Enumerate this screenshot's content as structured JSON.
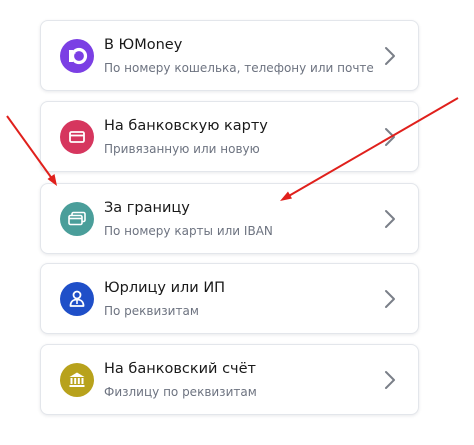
{
  "options": [
    {
      "title": "В ЮMoney",
      "subtitle": "По номеру кошелька, телефону или почте",
      "icon": "yoomoney-logo-icon",
      "color": "#7b3fe4"
    },
    {
      "title": "На банковскую карту",
      "subtitle": "Привязанную или новую",
      "icon": "bank-card-icon",
      "color": "#d6365e"
    },
    {
      "title": "За границу",
      "subtitle": "По номеру карты или IBAN",
      "icon": "cards-stack-icon",
      "color": "#4a9e9a"
    },
    {
      "title": "Юрлицу или ИП",
      "subtitle": "По реквизитам",
      "icon": "business-person-icon",
      "color": "#1f4fc8"
    },
    {
      "title": "На банковский счёт",
      "subtitle": "Физлицу по реквизитам",
      "icon": "bank-building-icon",
      "color": "#b8a21c"
    }
  ],
  "annotations": {
    "arrow_color": "#e0201c"
  }
}
